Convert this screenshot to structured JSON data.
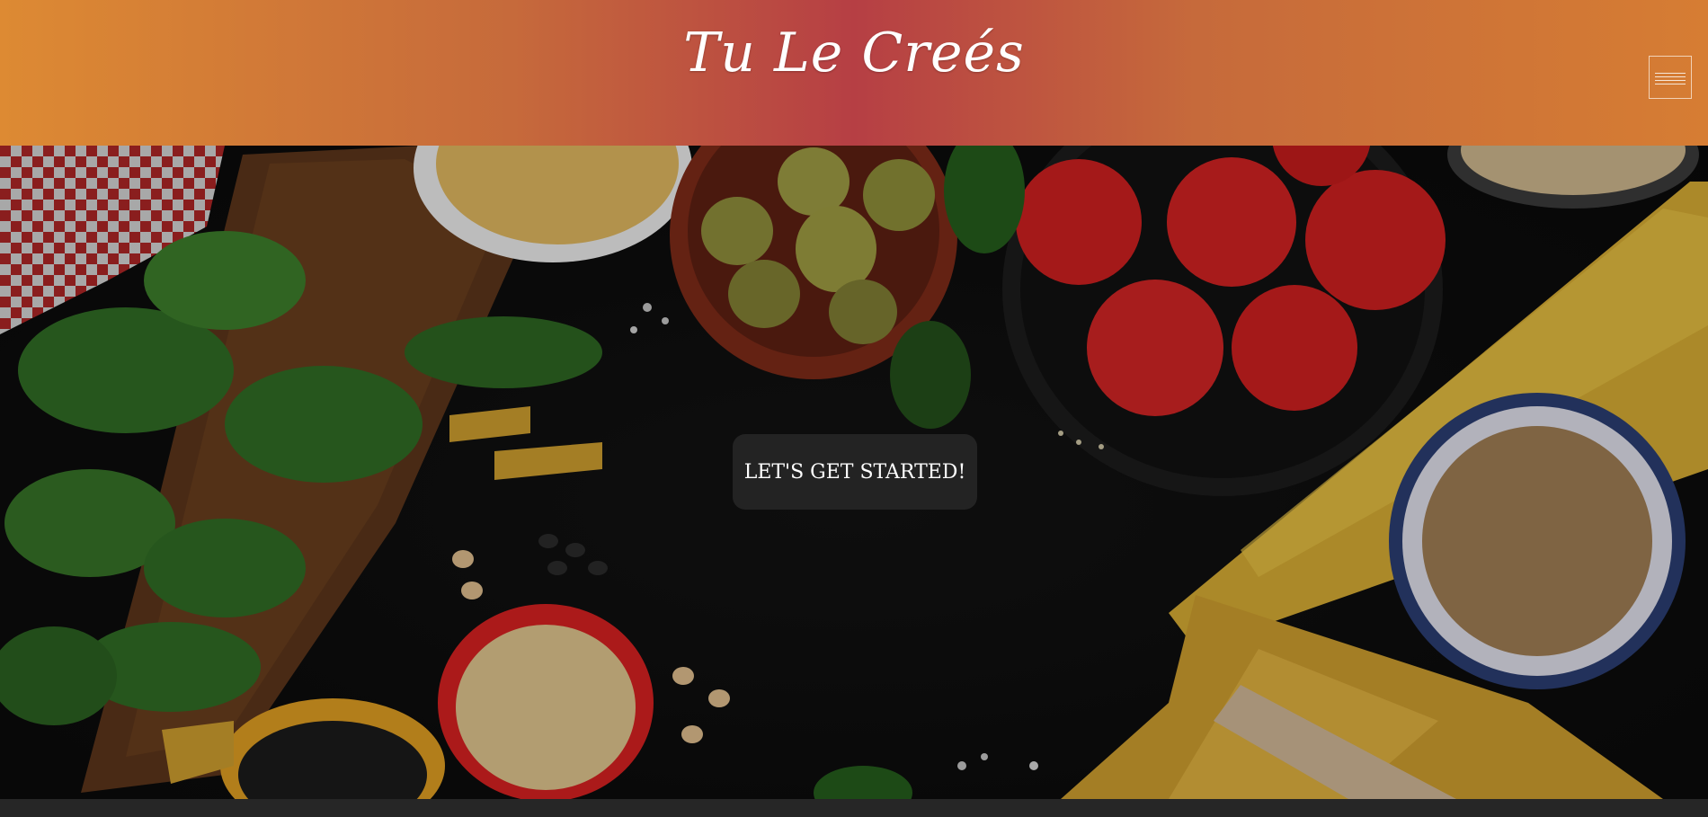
{
  "header": {
    "brand": "Tu Le Creés",
    "menu_icon": "hamburger-icon"
  },
  "hero": {
    "cta_label": "LET'S GET STARTED!",
    "background_image": "ingredients-photo"
  },
  "colors": {
    "header_gradient": [
      "#dd8a33",
      "#b63f44",
      "#d67d33"
    ],
    "cta_background": "#232323",
    "footer": "#262626"
  }
}
